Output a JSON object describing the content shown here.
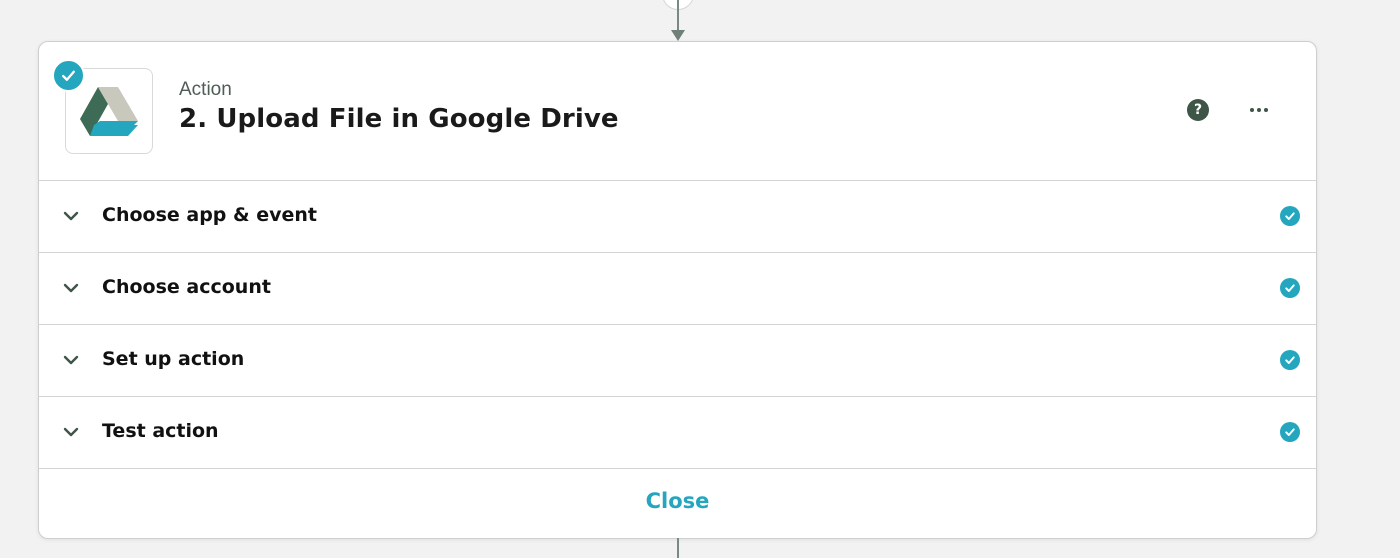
{
  "step": {
    "kind": "Action",
    "title": "2. Upload File in Google Drive",
    "app_icon": "google-drive-icon",
    "status": "complete"
  },
  "header_actions": {
    "help_icon": "question-icon",
    "help_glyph": "?",
    "more_icon": "more-horizontal-icon"
  },
  "sections": [
    {
      "label": "Choose app & event",
      "status": "complete"
    },
    {
      "label": "Choose account",
      "status": "complete"
    },
    {
      "label": "Set up action",
      "status": "complete"
    },
    {
      "label": "Test action",
      "status": "complete"
    }
  ],
  "footer": {
    "close_label": "Close"
  },
  "colors": {
    "accent": "#23a6be",
    "dark_green": "#3f5548",
    "background": "#f2f2f2",
    "card": "#ffffff"
  }
}
